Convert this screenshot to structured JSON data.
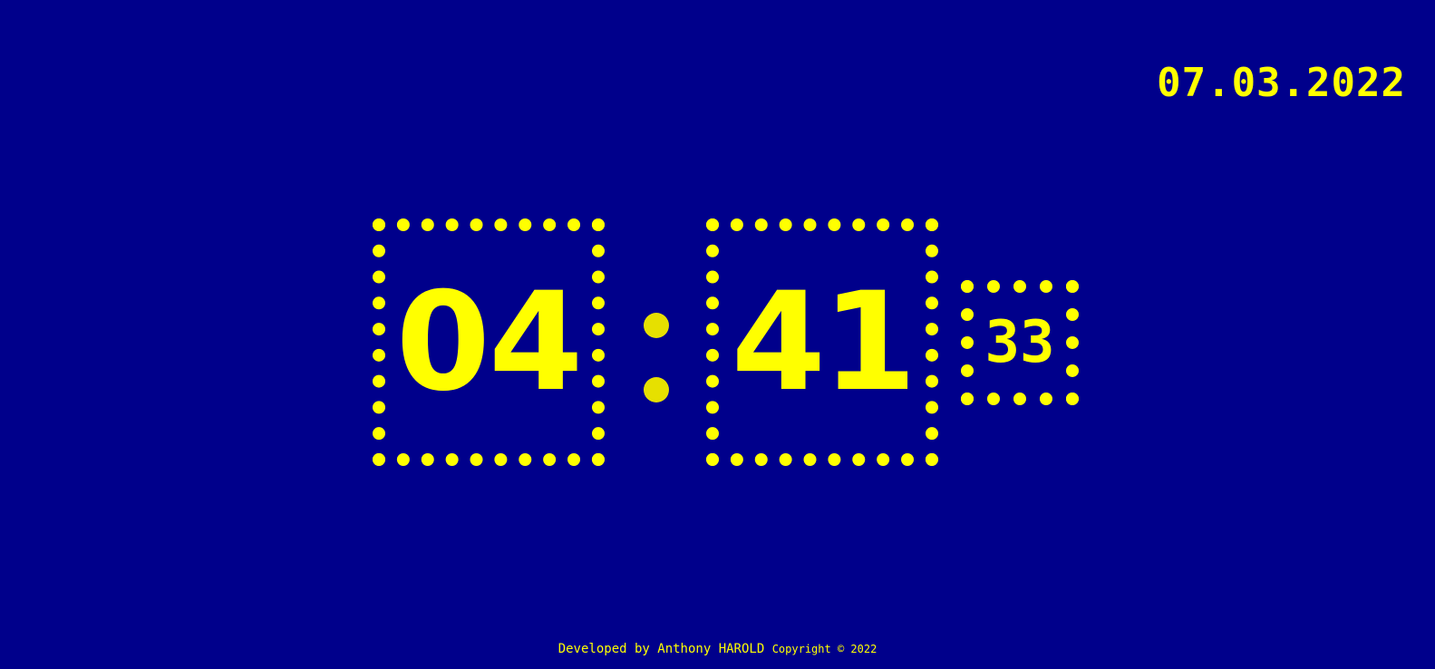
{
  "date": "07.03.2022",
  "clock": {
    "hours": "04",
    "minutes": "41",
    "seconds": "33"
  },
  "footer": {
    "developer": "Developed by Anthony HAROLD",
    "copyright": "Copyright © 2022"
  },
  "colors": {
    "background": "#00008b",
    "accent": "#ffff00"
  }
}
